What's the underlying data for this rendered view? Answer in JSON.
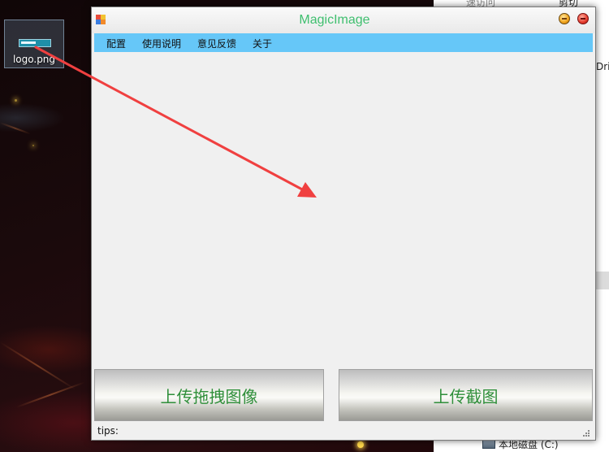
{
  "desktop": {
    "file_icon_label": "logo.png"
  },
  "explorer": {
    "text_top_left": "速访问",
    "text_top_right": "剪切",
    "text_side": "Dri",
    "drive_label": "本地磁盘 (C:)"
  },
  "window": {
    "title": "MagicImage",
    "title_color": "#3fbf6f",
    "menu_color": "#66c7f8",
    "menu": [
      {
        "label": "配置"
      },
      {
        "label": "使用说明"
      },
      {
        "label": "意见反馈"
      },
      {
        "label": "关于"
      }
    ],
    "buttons": {
      "upload_drag": "上传拖拽图像",
      "upload_screenshot": "上传截图"
    },
    "status": "tips:"
  },
  "annotation": {
    "arrow_color": "#f04040",
    "icon": "red-arrow-icon"
  }
}
